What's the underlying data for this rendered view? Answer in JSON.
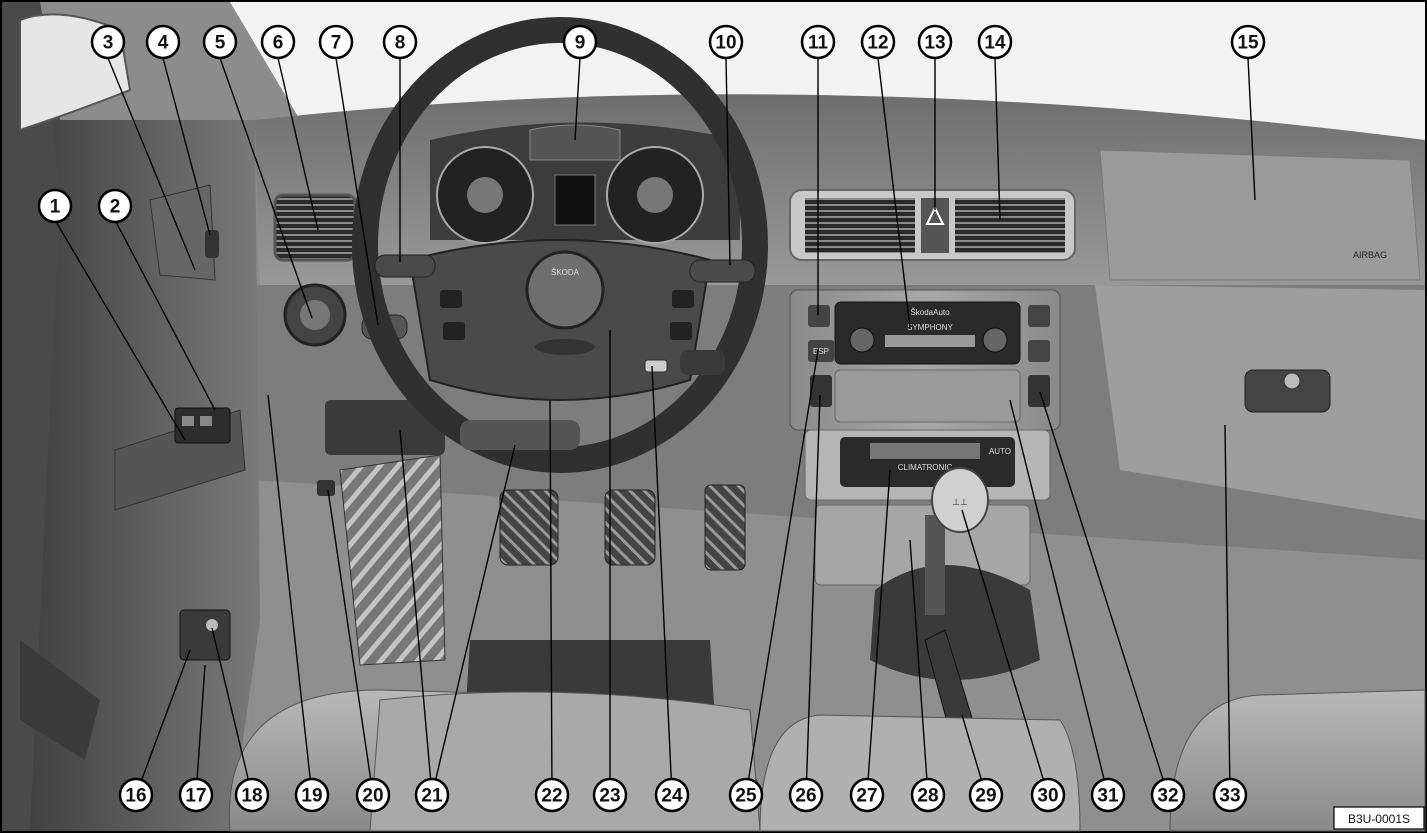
{
  "callouts": [
    "1",
    "2",
    "3",
    "4",
    "5",
    "6",
    "7",
    "8",
    "9",
    "10",
    "11",
    "12",
    "13",
    "14",
    "15",
    "16",
    "17",
    "18",
    "19",
    "20",
    "21",
    "22",
    "23",
    "24",
    "25",
    "26",
    "27",
    "28",
    "29",
    "30",
    "31",
    "32",
    "33"
  ],
  "figure_code": "B3U-0001S",
  "labels": {
    "brand": "ŠKODA",
    "radio_brand": "ŠkodaAuto",
    "radio_name": "SYMPHONY",
    "climate_name": "CLIMATRONIC",
    "esp": "ESP",
    "auto": "AUTO",
    "airbag": "AIRBAG"
  }
}
